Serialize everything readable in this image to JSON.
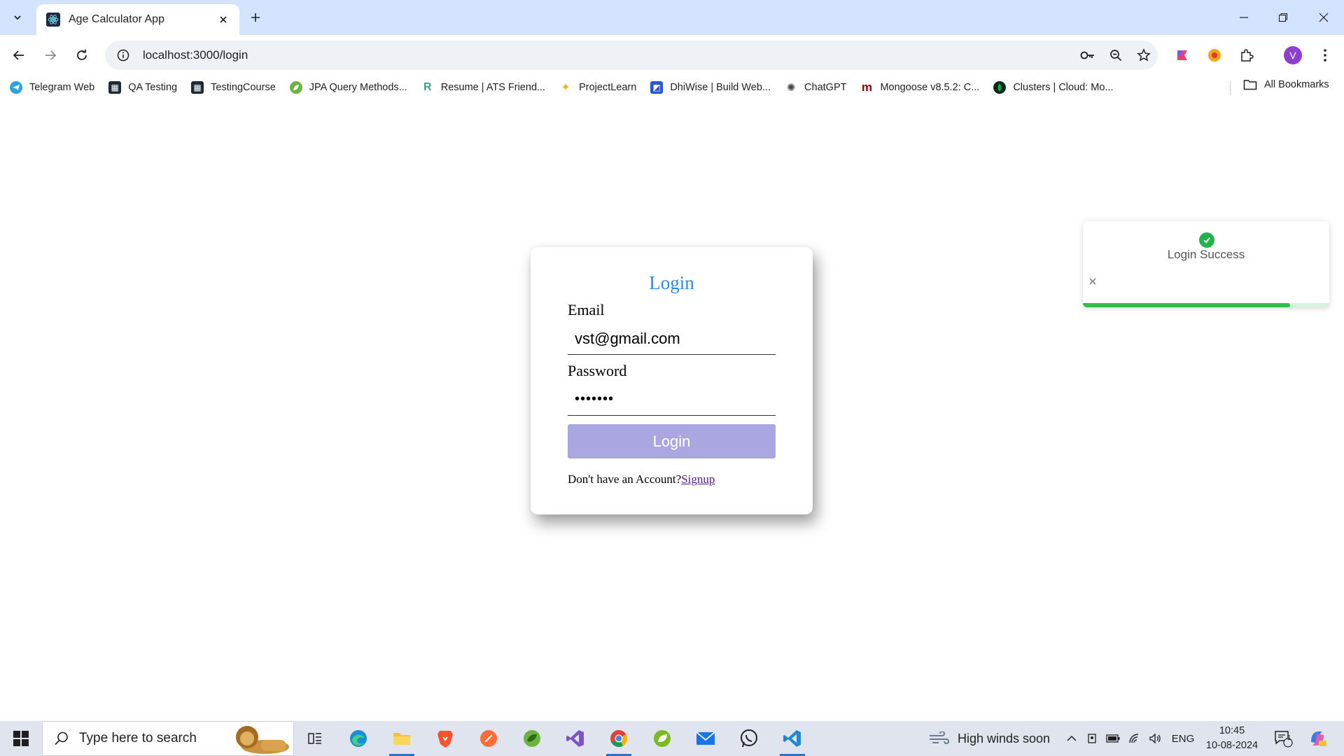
{
  "browser": {
    "tab_title": "Age Calculator App",
    "url": "localhost:3000/login",
    "profile_initial": "V"
  },
  "bookmarks": {
    "items": [
      {
        "label": "Telegram Web",
        "icon": "telegram-icon",
        "color": "#2aa3e0"
      },
      {
        "label": "QA Testing",
        "icon": "qa-testing-icon",
        "color": "#1e2a38"
      },
      {
        "label": "TestingCourse",
        "icon": "testing-course-icon",
        "color": "#1e2a38"
      },
      {
        "label": "JPA Query Methods...",
        "icon": "spring-icon",
        "color": "#6db33f"
      },
      {
        "label": "Resume | ATS Friend...",
        "icon": "resume-icon",
        "color": "#3aa58a"
      },
      {
        "label": "ProjectLearn",
        "icon": "projectlearn-icon",
        "color": "#f2b01e"
      },
      {
        "label": "DhiWise | Build Web...",
        "icon": "dhiwise-icon",
        "color": "#2b56d6"
      },
      {
        "label": "ChatGPT",
        "icon": "chatgpt-icon",
        "color": "#444444"
      },
      {
        "label": "Mongoose v8.5.2: C...",
        "icon": "mongoose-icon",
        "color": "#880000"
      },
      {
        "label": "Clusters | Cloud: Mo...",
        "icon": "mongodb-icon",
        "color": "#13aa52"
      }
    ],
    "all_bookmarks": "All Bookmarks"
  },
  "login": {
    "title": "Login",
    "email_label": "Email",
    "email_value": "vst@gmail.com",
    "password_label": "Password",
    "password_value": "•••••••",
    "button_label": "Login",
    "signup_prompt": "Don't have an Account?",
    "signup_link": "Signup"
  },
  "toast": {
    "message": "Login Success",
    "progress": 0.84,
    "status_color": "#21b24b"
  },
  "taskbar": {
    "search_placeholder": "Type here to search",
    "weather": "High winds soon",
    "language": "ENG",
    "time": "10:45",
    "date": "10-08-2024",
    "notification_count": "1"
  },
  "colors": {
    "accent": "#2b8ae6",
    "button": "#aaa6e2",
    "tabstrip": "#d3e3fd"
  }
}
